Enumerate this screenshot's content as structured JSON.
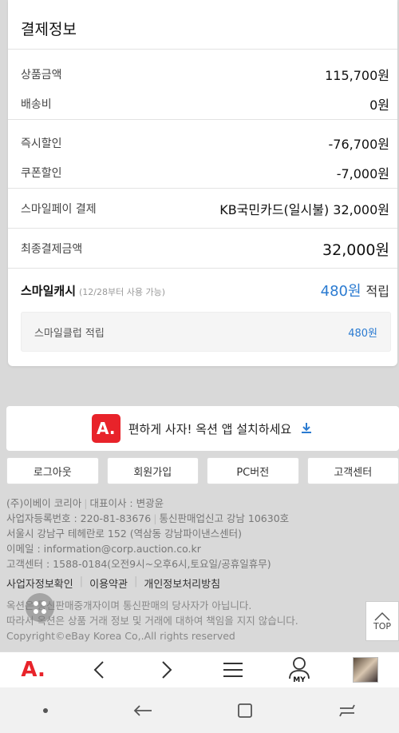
{
  "payment": {
    "title": "결제정보",
    "product_amount": {
      "label": "상품금액",
      "value": "115,700원"
    },
    "shipping": {
      "label": "배송비",
      "value": "0원"
    },
    "instant_discount": {
      "label": "즉시할인",
      "value": "-76,700원"
    },
    "coupon_discount": {
      "label": "쿠폰할인",
      "value": "-7,000원"
    },
    "smilepay": {
      "label": "스마일페이 결제",
      "value": "KB국민카드(일시불) 32,000원"
    },
    "final": {
      "label": "최종결제금액",
      "value": "32,000원"
    },
    "smilecash": {
      "label": "스마일캐시",
      "sub": "(12/28부터 사용 가능)",
      "amount": "480원",
      "suffix": "적립"
    },
    "smileclub": {
      "label": "스마일클럽 적립",
      "value": "480원"
    }
  },
  "app_banner": {
    "logo": "A.",
    "text": "편하게 사자! 옥션 앱 설치하세요",
    "icon": "download-icon"
  },
  "footer_buttons": [
    "로그아웃",
    "회원가입",
    "PC버전",
    "고객센터"
  ],
  "company": {
    "name": "(주)이베이 코리아",
    "ceo": "대표이사 : 변광윤",
    "biz_no": "사업자등록번호 : 220-81-83676",
    "mail_order": "통신판매업신고 강남 10630호",
    "address": "서울시 강남구 테헤란로 152 (역삼동 강남파이낸스센터)",
    "email": "이메일 : information@corp.auction.co.kr",
    "cs": "고객센터 : 1588-0184(오전9시~오후6시,토요일/공휴일휴무)"
  },
  "links": [
    "사업자정보확인",
    "이용약관",
    "개인정보처리방침"
  ],
  "notice": {
    "line1": "옥션은 통신판매중개자이며 통신판매의 당사자가 아닙니다.",
    "line2": "따라서 옥션은 상품 거래 정보 및 거래에 대하여 책임을 지지 않습니다.",
    "copyright": "Copyright©eBay Korea Co,.All rights reserved"
  },
  "top_button": "TOP",
  "app_nav": {
    "logo": "A.",
    "my": "MY"
  },
  "colors": {
    "accent_blue": "#2b7bd1",
    "brand_red": "#e8232a"
  }
}
